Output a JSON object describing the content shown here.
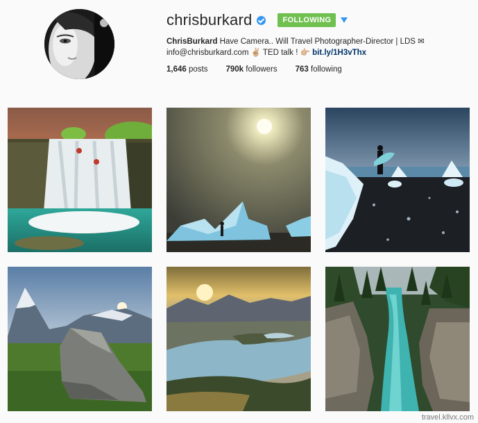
{
  "profile": {
    "username": "chrisburkard",
    "follow_label": "FOLLOWING",
    "bio_name": "ChrisBurkard",
    "bio_text": " Have Camera.. Will Travel Photographer-Director | LDS ✉",
    "bio_line2": "info@chrisburkard.com ✌🏼 TED talk ! 👉🏼 ",
    "bio_link": "bit.ly/1H3vThx",
    "stats": {
      "posts_count": "1,646",
      "posts_label": " posts",
      "followers_count": "790k",
      "followers_label": " followers",
      "following_count": "763",
      "following_label": " following"
    }
  },
  "photos": [
    {
      "subject": "waterfall"
    },
    {
      "subject": "moon-iceberg"
    },
    {
      "subject": "surfer-ice"
    },
    {
      "subject": "matterhorn"
    },
    {
      "subject": "lake-valley"
    },
    {
      "subject": "canyon-river"
    }
  ],
  "watermark": "travel.kllvx.com",
  "colors": {
    "following_green": "#70c050",
    "verified_blue": "#3897f0"
  }
}
